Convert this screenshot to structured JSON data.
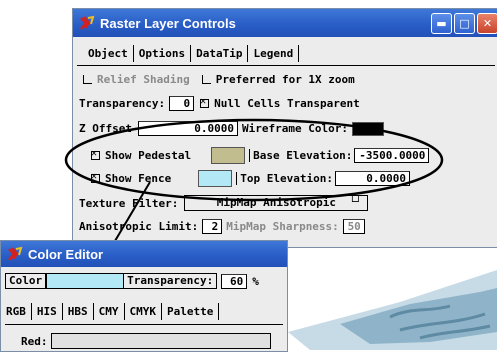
{
  "raster_window": {
    "title": "Raster Layer Controls",
    "tabs": [
      "Object",
      "Options",
      "DataTip",
      "Legend"
    ],
    "relief_shading_label": "Relief Shading",
    "preferred_label": "Preferred for 1X zoom",
    "transparency_label": "Transparency:",
    "transparency_value": "0",
    "null_cells_label": "Null Cells Transparent",
    "z_offset_label": "Z Offset",
    "z_offset_value": "0.0000",
    "wireframe_label": "Wireframe Color:",
    "show_pedestal_label": "Show Pedestal",
    "base_elevation_label": "Base Elevation:",
    "base_elevation_value": "-3500.0000",
    "show_fence_label": "Show Fence",
    "top_elevation_label": "Top Elevation:",
    "top_elevation_value": "0.0000",
    "texture_filter_label": "Texture Filter:",
    "texture_filter_value": "MipMap Anisotropic",
    "aniso_label": "Anisotropic Limit:",
    "aniso_value": "2",
    "mipmap_label": "MipMap Sharpness:",
    "mipmap_value": "50"
  },
  "color_editor": {
    "title": "Color Editor",
    "color_label": "Color",
    "transparency_label": "Transparency:",
    "transparency_value": "60",
    "percent": "%",
    "tabs": [
      "RGB",
      "HIS",
      "HBS",
      "CMY",
      "CMYK",
      "Palette"
    ],
    "red_label": "Red:"
  },
  "colors": {
    "pedestal": "#c2bd8e",
    "fence": "#b3e9f6",
    "wireframe": "#000000",
    "title_bar": "#2a5ec7"
  },
  "icons": [
    "app-icon",
    "minimize-icon",
    "maximize-icon",
    "close-icon"
  ]
}
